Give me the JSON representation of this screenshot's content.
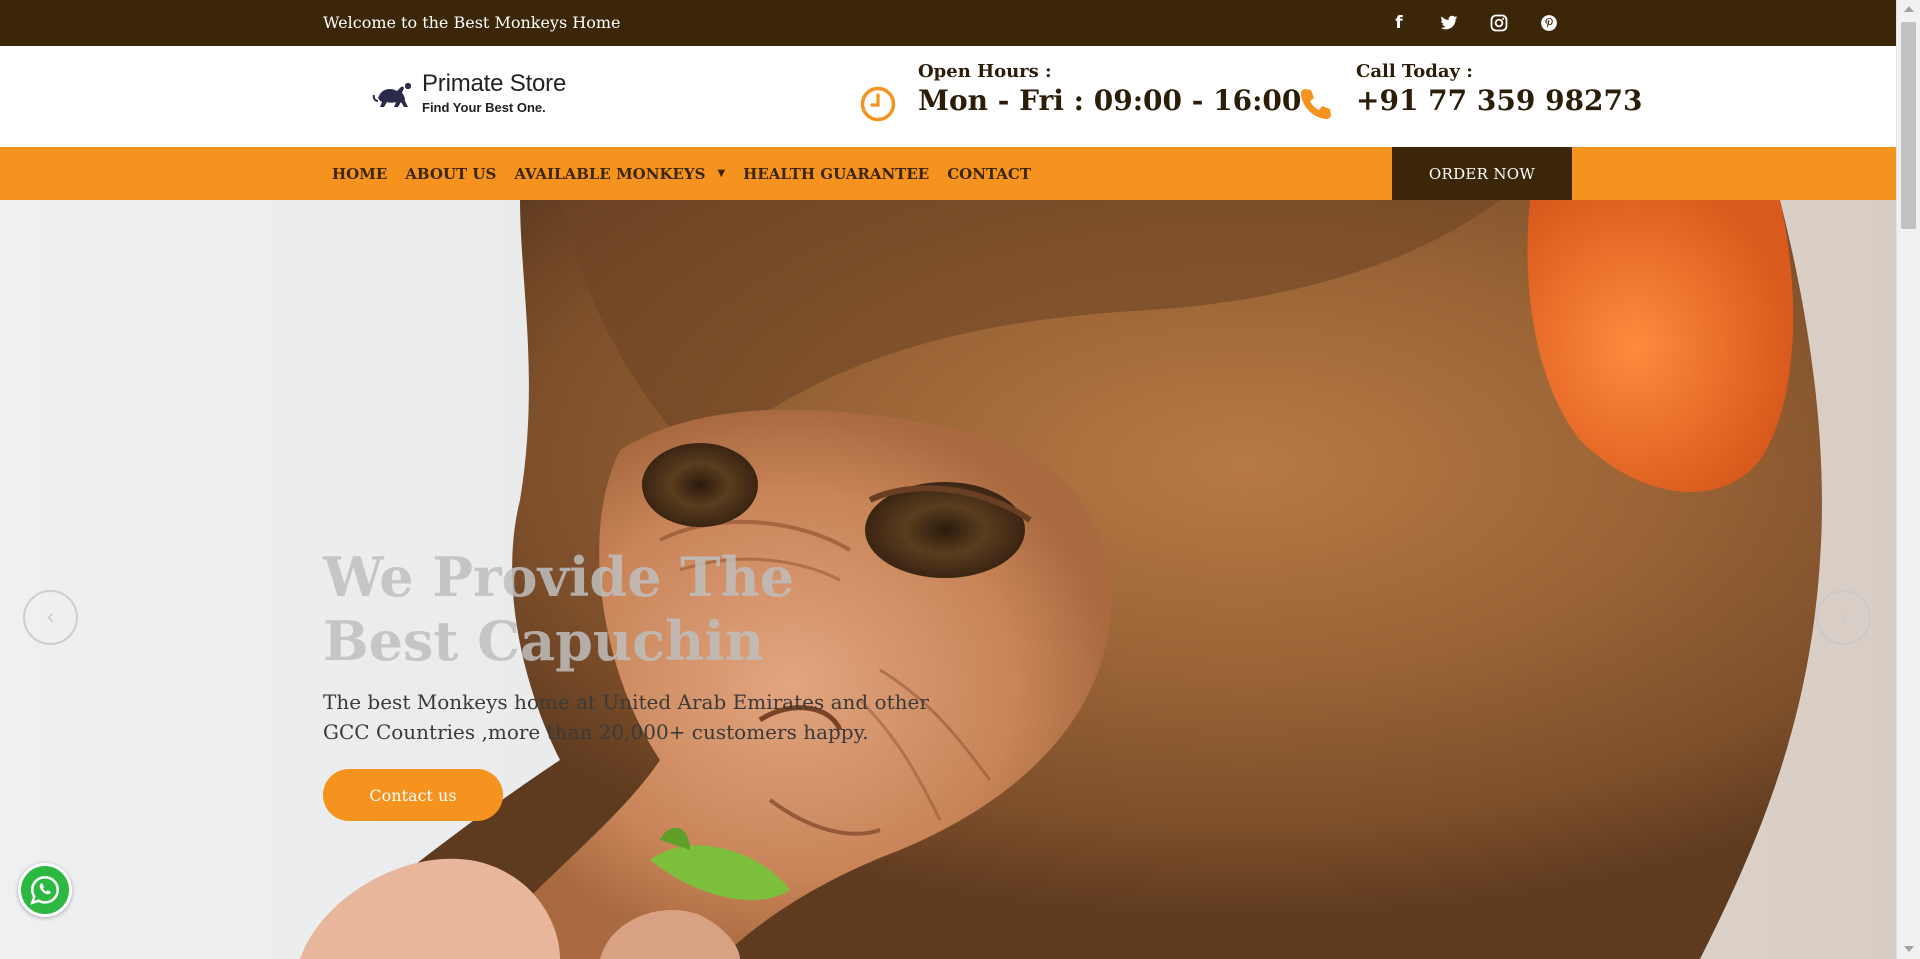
{
  "topbar": {
    "welcome": "Welcome to the Best Monkeys Home",
    "social": [
      {
        "icon": "facebook-icon",
        "glyph": "f"
      },
      {
        "icon": "twitter-icon",
        "glyph": "t"
      },
      {
        "icon": "instagram-icon",
        "glyph": "◎"
      },
      {
        "icon": "pinterest-icon",
        "glyph": "P"
      }
    ]
  },
  "header": {
    "logo_name": "Primate Store",
    "logo_tagline": "Find Your Best One.",
    "hours_label": "Open Hours :",
    "hours_value": "Mon - Fri : 09:00 - 16:00",
    "call_label": "Call Today :",
    "call_value": "+91 77 359 98273"
  },
  "nav": {
    "items": [
      "HOME",
      "ABOUT US",
      "AVAILABLE MONKEYS",
      "HEALTH GUARANTEE",
      "CONTACT"
    ],
    "order_label": "ORDER NOW"
  },
  "hero": {
    "headline": "We Provide The Best Capuchin",
    "subtext": "The best Monkeys home at United Arab Emirates and other GCC Countries ,more than 20,000+ customers happy.",
    "cta_label": "Contact us",
    "prev_arrow": "‹",
    "next_arrow": "›"
  },
  "colors": {
    "brand_dark": "#3b2608",
    "brand_orange": "#f6921e",
    "whatsapp_green": "#2db842"
  }
}
